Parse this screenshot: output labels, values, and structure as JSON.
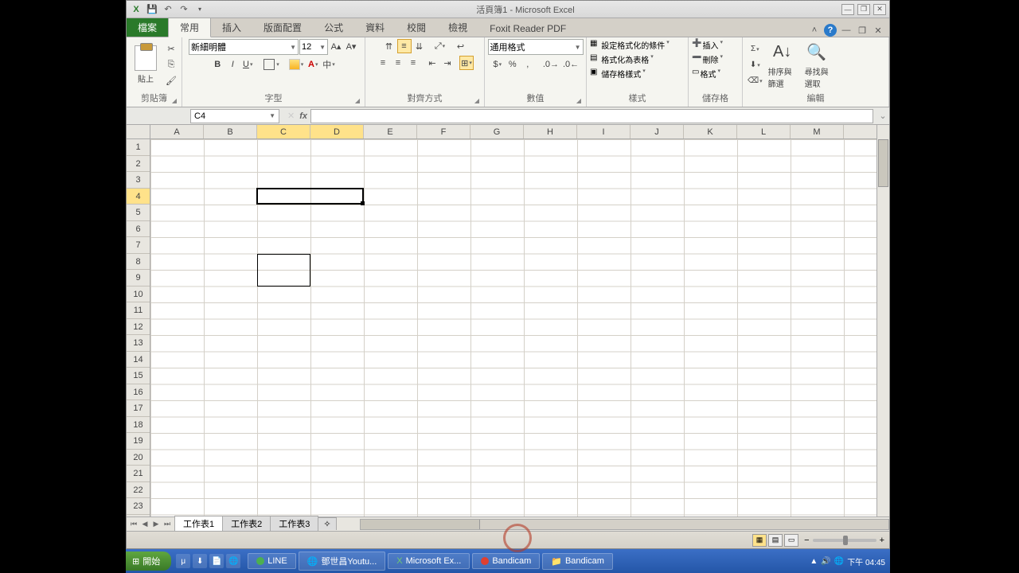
{
  "title": "活頁簿1 - Microsoft Excel",
  "tabs": {
    "file": "檔案",
    "home": "常用",
    "insert": "插入",
    "layout": "版面配置",
    "formula": "公式",
    "data": "資料",
    "review": "校閱",
    "view": "檢視",
    "pdf": "Foxit Reader PDF"
  },
  "groups": {
    "clipboard": "剪貼簿",
    "font": "字型",
    "align": "對齊方式",
    "number": "數值",
    "styles": "樣式",
    "cells": "儲存格",
    "editing": "編輯"
  },
  "clipboard": {
    "paste": "貼上"
  },
  "font": {
    "name": "新細明體",
    "size": "12"
  },
  "number": {
    "format": "通用格式"
  },
  "styles": {
    "cond": "設定格式化的條件",
    "table": "格式化為表格",
    "cell": "儲存格樣式"
  },
  "cells_grp": {
    "insert": "插入",
    "delete": "刪除",
    "format": "格式"
  },
  "editing": {
    "sort": "排序與篩選",
    "find": "尋找與\n選取"
  },
  "namebox": "C4",
  "columns": [
    "A",
    "B",
    "C",
    "D",
    "E",
    "F",
    "G",
    "H",
    "I",
    "J",
    "K",
    "L",
    "M"
  ],
  "rows": [
    "1",
    "2",
    "3",
    "4",
    "5",
    "6",
    "7",
    "8",
    "9",
    "10",
    "11",
    "12",
    "13",
    "14",
    "15",
    "16",
    "17",
    "18",
    "19",
    "20",
    "21",
    "22",
    "23"
  ],
  "selected_cols": [
    "C",
    "D"
  ],
  "selected_row": "4",
  "sheets": {
    "s1": "工作表1",
    "s2": "工作表2",
    "s3": "工作表3"
  },
  "taskbar": {
    "start": "開始",
    "line": "LINE",
    "yt": "鄧世昌Youtu...",
    "excel": "Microsoft Ex...",
    "bc1": "Bandicam",
    "bc2": "Bandicam",
    "time": "下午 04:45"
  }
}
